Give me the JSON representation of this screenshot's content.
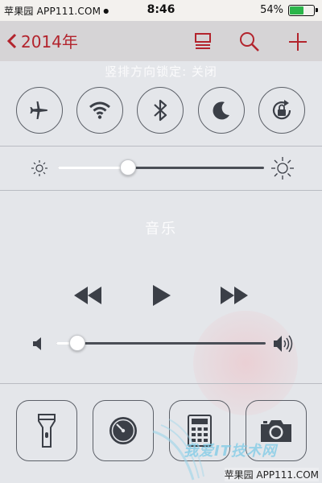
{
  "status_bar": {
    "carrier": "苹果园 APP111.COM",
    "time": "8:46",
    "battery_percent": "54%",
    "battery_level": 0.54,
    "battery_color": "#2bb54a"
  },
  "nav_bar": {
    "back_label": "2014年",
    "accent_color": "#b3242d",
    "icons": [
      "list-icon",
      "search-icon",
      "add-icon"
    ]
  },
  "control_center": {
    "lock_notice": "竖排方向锁定: 关闭",
    "toggles": [
      {
        "name": "airplane-mode",
        "icon": "airplane-icon"
      },
      {
        "name": "wifi",
        "icon": "wifi-icon"
      },
      {
        "name": "bluetooth",
        "icon": "bluetooth-icon"
      },
      {
        "name": "do-not-disturb",
        "icon": "moon-icon"
      },
      {
        "name": "rotation-lock",
        "icon": "rotation-lock-icon"
      }
    ],
    "brightness_level": 0.34,
    "music_title": "音乐",
    "volume_level": 0.1,
    "media_controls": [
      "rewind-icon",
      "play-icon",
      "fast-forward-icon"
    ],
    "apps": [
      "flashlight-icon",
      "timer-icon",
      "calculator-icon",
      "camera-icon"
    ]
  },
  "watermark": {
    "text_bottom": "苹果园 APP111.COM",
    "text_logo": "我爱IT技术网"
  }
}
